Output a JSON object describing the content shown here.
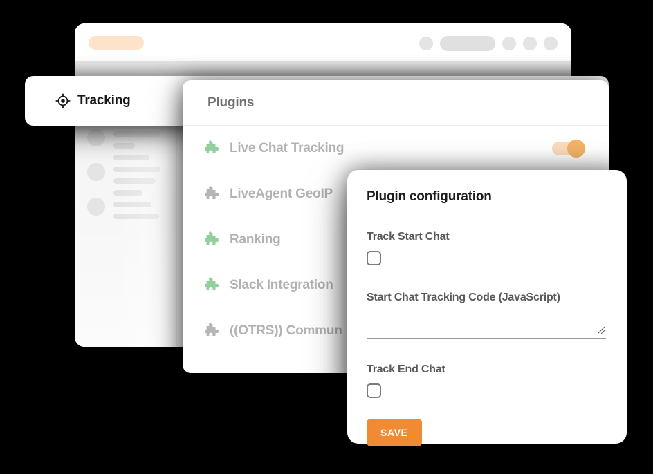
{
  "browser": {
    "address_pill": "",
    "toolbar_icons": [
      "circle-placeholder",
      "bar-placeholder",
      "circle-placeholder",
      "circle-placeholder",
      "circle-placeholder"
    ],
    "accent_peach": "#fde3c9",
    "skeleton_gray": "#e2e2e2"
  },
  "header": {
    "icon": "crosshair-target-icon",
    "title": "Tracking",
    "tab_label": "Plugins",
    "close_icon": "close-icon"
  },
  "plugins_panel": {
    "heading": "Plugins",
    "rows": [
      {
        "name": "Live Chat Tracking",
        "icon": "puzzle-icon",
        "icon_color": "#92cf9c",
        "enabled": true
      },
      {
        "name": "LiveAgent GeoIP",
        "icon": "puzzle-icon",
        "icon_color": "#b5b5b5",
        "enabled": false
      },
      {
        "name": "Ranking",
        "icon": "puzzle-icon",
        "icon_color": "#92cf9c",
        "enabled": false
      },
      {
        "name": "Slack Integration",
        "icon": "puzzle-icon",
        "icon_color": "#92cf9c",
        "enabled": false
      },
      {
        "name": "((OTRS)) Commun",
        "icon": "puzzle-icon",
        "icon_color": "#b5b5b5",
        "enabled": false
      }
    ],
    "toggle_on_track": "#fbdcbc",
    "toggle_on_knob": "#f3b266"
  },
  "config_panel": {
    "title": "Plugin configuration",
    "track_start_chat_label": "Track Start Chat",
    "track_start_chat_checked": false,
    "tracking_code_label": "Start Chat Tracking Code (JavaScript)",
    "tracking_code_value": "",
    "tracking_code_placeholder": "",
    "track_end_chat_label": "Track End Chat",
    "track_end_chat_checked": false,
    "save_label": "SAVE",
    "save_color": "#f08a33"
  }
}
